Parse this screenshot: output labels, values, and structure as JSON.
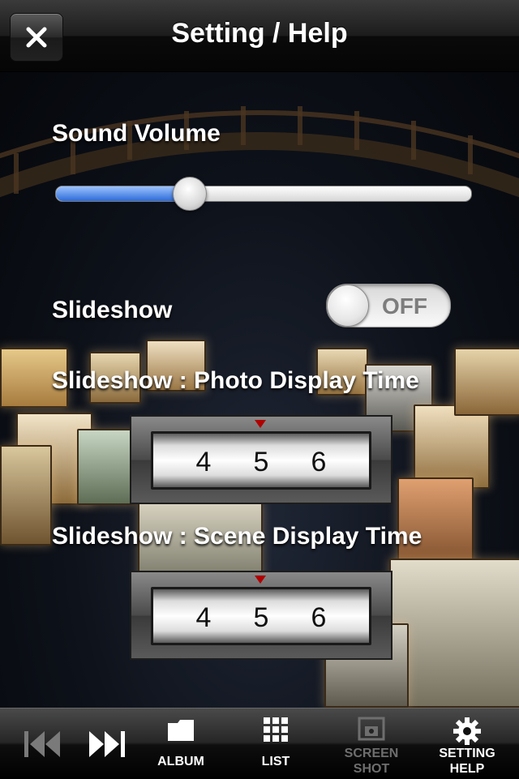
{
  "header": {
    "title": "Setting / Help",
    "close_icon": "close-icon"
  },
  "settings": {
    "sound_volume": {
      "label": "Sound Volume",
      "value": 0.32
    },
    "slideshow": {
      "label": "Slideshow",
      "state": "OFF"
    },
    "photo_display_time": {
      "label": "Slideshow : Photo Display Time",
      "values": [
        "4",
        "5",
        "6"
      ]
    },
    "scene_display_time": {
      "label": "Slideshow : Scene Display Time",
      "values": [
        "4",
        "5",
        "6"
      ]
    }
  },
  "toolbar": {
    "items": [
      {
        "icon": "previous-icon",
        "label": ""
      },
      {
        "icon": "next-icon",
        "label": ""
      },
      {
        "icon": "folder-icon",
        "label": "ALBUM"
      },
      {
        "icon": "grid-icon",
        "label": "LIST"
      },
      {
        "icon": "screenshot-icon",
        "label": "SCREEN\nSHOT"
      },
      {
        "icon": "gear-icon",
        "label": "SETTING\nHELP"
      }
    ]
  },
  "colors": {
    "slider_fill": "#2c6bd8",
    "picker_marker": "#b00000",
    "disabled_text": "#6e6e6e"
  }
}
